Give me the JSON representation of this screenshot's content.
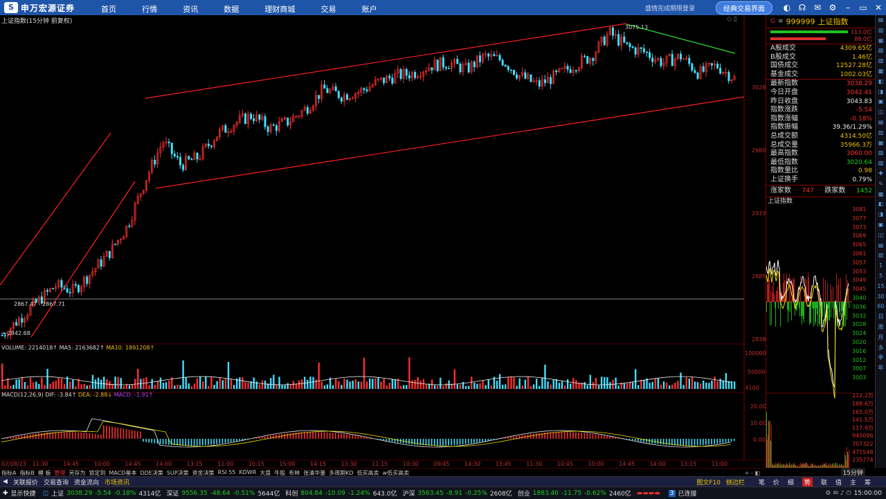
{
  "topbar": {
    "logo_text": "申万宏源证券",
    "nav": [
      "首页",
      "行情",
      "资讯",
      "数据",
      "理财商城",
      "交易",
      "账户"
    ],
    "user_hint": "盛情完成期限登录",
    "classic_button": "经典交易界面"
  },
  "chart": {
    "title": "上证指数(15分钟 前复权)",
    "annotation_high": "3075.13",
    "annotation_mid": "2867.47 - 2867.71",
    "annotation_low": "←2842.68",
    "yticks": [
      "3028",
      "2980",
      "2933",
      "2885",
      "2838"
    ],
    "volume_title": "VOLUME: 2214018↑",
    "ma5_title": "MA5: 2163682↑",
    "ma10_title": "MA10: 1891208↑",
    "vol_ticks": [
      "100000",
      "50000",
      "X100"
    ],
    "macd_title": "MACD(12,26,9)",
    "dif_title": "DIF: -3.84↑",
    "dea_title": "DEA: -2.88↓",
    "macd_val_title": "MACD: -1.91↑",
    "macd_ticks": [
      "20.00",
      "10.00",
      "0.00"
    ],
    "xticks": [
      "02/08/23",
      "11:30",
      "14:45",
      "10:00",
      "14:45",
      "14:00",
      "13:15",
      "11:00",
      "10:15",
      "15:00",
      "14:15",
      "13:30",
      "11:15",
      "10:30",
      "09/45",
      "14:30",
      "13:45",
      "11:30",
      "10:45",
      "10:00",
      "14:45",
      "14:00",
      "13:15",
      "11:00"
    ],
    "period_label": "15分钟"
  },
  "chart_data": {
    "type": "candlestick",
    "title": "上证指数(15分钟 前复权)",
    "ylim": [
      2838,
      3080
    ],
    "approx_close": [
      2842,
      2855,
      2868,
      2880,
      2876,
      2890,
      2905,
      2925,
      2960,
      2990,
      2972,
      2978,
      2995,
      3004,
      3010,
      3000,
      3005,
      3015,
      3030,
      3025,
      3028,
      3035,
      3040,
      3042,
      3048,
      3050,
      3045,
      3055,
      3052,
      3040,
      3033,
      3040,
      3048,
      3055,
      3073,
      3062,
      3058,
      3050,
      3055,
      3042,
      3048,
      3038
    ]
  },
  "panel": {
    "code": "999999",
    "name": "上证指数",
    "flag": "G",
    "bar_top_value": "113.0亿",
    "bar_bot_value": "88.0亿",
    "rows": [
      {
        "k": "A股成交",
        "v": "4309.65亿",
        "c": "vy"
      },
      {
        "k": "B股成交",
        "v": "1.46亿",
        "c": "vy"
      },
      {
        "k": "国债成交",
        "v": "12527.28亿",
        "c": "vy"
      },
      {
        "k": "基金成交",
        "v": "1002.03亿",
        "c": "vy"
      },
      {
        "k": "最新指数",
        "v": "3038.29",
        "c": "vr"
      },
      {
        "k": "今日开盘",
        "v": "3042.41",
        "c": "vr"
      },
      {
        "k": "昨日收盘",
        "v": "3043.83",
        "c": "vw"
      },
      {
        "k": "指数涨跌",
        "v": "-5.54",
        "c": "vr"
      },
      {
        "k": "指数涨幅",
        "v": "-0.18%",
        "c": "vr"
      },
      {
        "k": "指数振幅",
        "v": "39.36/1.29%",
        "c": "vw"
      },
      {
        "k": "总成交额",
        "v": "4314.50亿",
        "c": "vy"
      },
      {
        "k": "总成交量",
        "v": "35966.3万",
        "c": "vy"
      },
      {
        "k": "最高指数",
        "v": "3060.00",
        "c": "vr"
      },
      {
        "k": "最低指数",
        "v": "3020.64",
        "c": "vg"
      },
      {
        "k": "指数量比",
        "v": "0.98",
        "c": "vy"
      },
      {
        "k": "上证换手",
        "v": "0.79%",
        "c": "vw"
      }
    ],
    "up_label": "涨家数",
    "up_count": "747",
    "down_label": "跌家数",
    "down_count": "1452",
    "mini_title": "上证指数",
    "mini_ticks": [
      "3081",
      "3077",
      "3073",
      "3069",
      "3065",
      "3061",
      "3057",
      "3053",
      "3049",
      "3045",
      "3040",
      "3036",
      "3032",
      "3028",
      "3024",
      "3020",
      "3016",
      "3012",
      "3007",
      "3003",
      "212.2万",
      "188.6万",
      "165.0万",
      "141.5万",
      "117.9万",
      "943096",
      "707322",
      "471548",
      "235774"
    ]
  },
  "right_toolbar": [
    "1",
    "5",
    "15",
    "30",
    "60",
    "日",
    "周",
    "月",
    "多",
    "季",
    "年"
  ],
  "tabs1": {
    "items": [
      "指标A",
      "指标B",
      "模 板",
      "管理",
      "另存为",
      "锁定到",
      "MACD基本",
      "DDE决策",
      "SUP决策",
      "资金决策",
      "RSI 55",
      "KDWR",
      "大盘",
      "牛股",
      "布林",
      "张清华量",
      "多周期KD",
      "低买高卖",
      "w低买高卖"
    ],
    "active_index": 3
  },
  "tabs2": {
    "items": [
      "关联报价",
      "交易查询",
      "资金流向",
      "市场资讯"
    ],
    "active_index": 3,
    "right_items": [
      "图文F10",
      "侧边栏"
    ],
    "panel_tabs": [
      "笔",
      "价",
      "细",
      "势",
      "联",
      "值",
      "主",
      "筹"
    ],
    "panel_active": 3
  },
  "status": {
    "show_quick": "显示快捷",
    "sh": {
      "name": "上证",
      "price": "3038.29",
      "chg": "-5.54",
      "pct": "-0.18%",
      "amt": "4314亿"
    },
    "sz": {
      "name": "深证",
      "price": "9556.35",
      "chg": "-48.64",
      "pct": "-0.51%",
      "amt": "5644亿"
    },
    "kc": {
      "name": "科创",
      "price": "804.84",
      "chg": "-10.09",
      "pct": "-1.24%",
      "amt": "643.0亿"
    },
    "hs": {
      "name": "沪深",
      "price": "3563.45",
      "chg": "-8.91",
      "pct": "-0.25%",
      "amt": "2608亿"
    },
    "cy": {
      "name": "创业",
      "price": "1883.40",
      "chg": "-11.75",
      "pct": "-0.62%",
      "amt": "2460亿"
    },
    "conn_count": "3",
    "conn": "已连接",
    "time": "15:00:00"
  }
}
